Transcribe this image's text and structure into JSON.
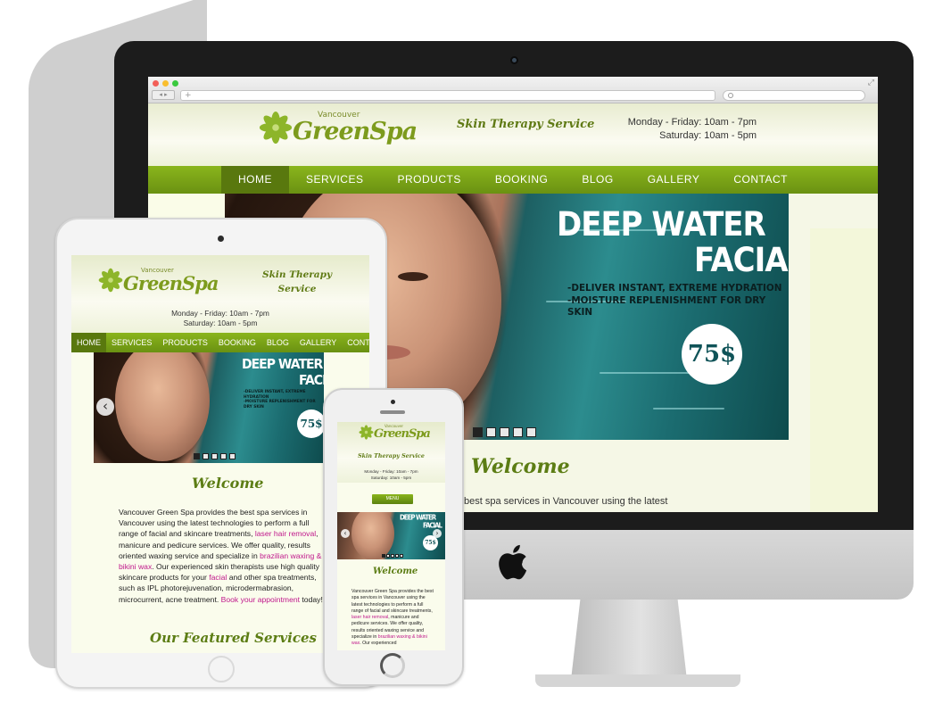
{
  "brand": {
    "logo_small": "Vancouver",
    "logo_main": "GreenSpa",
    "tagline": "Skin Therapy Service",
    "tagline_line1": "Skin Therapy",
    "tagline_line2": "Service",
    "hours_weekday": "Monday - Friday: 10am - 7pm",
    "hours_saturday": "Saturday: 10am - 5pm",
    "colors": {
      "nav_green": "#7aa318",
      "heading_green": "#5c7d14",
      "link_pink": "#c0188c"
    }
  },
  "browser": {
    "new_tab": "+"
  },
  "nav": {
    "items": [
      "HOME",
      "SERVICES",
      "PRODUCTS",
      "BOOKING",
      "BLOG",
      "GALLERY",
      "CONTACT"
    ],
    "active": "HOME",
    "menu_label": "MENU"
  },
  "hero": {
    "title_line1": "DEEP WATER",
    "title_line2": "FACIAL",
    "bullet1": "-DELIVER INSTANT, EXTREME HYDRATION",
    "bullet2": "-MOISTURE REPLENISHMENT FOR DRY SKIN",
    "price": "75$",
    "slide_count": 5,
    "active_slide": 1
  },
  "welcome": {
    "heading": "Welcome",
    "imac_snippet": "best spa services in Vancouver using the latest",
    "p1": "Vancouver Green Spa provides the best spa services in Vancouver using the latest technologies to perform a full range of facial and skincare treatments, ",
    "link_laser": "laser hair removal",
    "p2": ", manicure and pedicure services. We offer quality, results oriented waxing service and specialize in ",
    "link_waxing": "brazilian waxing & bikini wax",
    "p3": ". Our experienced skin therapists use high quality skincare products for your ",
    "link_facial": "facial",
    "p4": " and other spa treatments, such as IPL photorejuvenation, microdermabrasion, microcurrent, acne treatment. ",
    "link_book": "Book your appointment",
    "p5": " today!",
    "phone_p2": ", manicure and pedicure services. We offer quality, results oriented waxing service and specialize in ",
    "phone_p3": ". Our experienced"
  },
  "featured": {
    "heading": "Our Featured Services"
  },
  "icons": {
    "logo": "lotus-flower-icon",
    "apple": "apple-logo-icon",
    "prev": "chevron-left-icon",
    "next": "chevron-right-icon",
    "search": "magnifier-icon",
    "expand": "expand-icon",
    "arrows": "back-forward-icon",
    "left_arrow": "‹",
    "right_arrow": "›"
  }
}
